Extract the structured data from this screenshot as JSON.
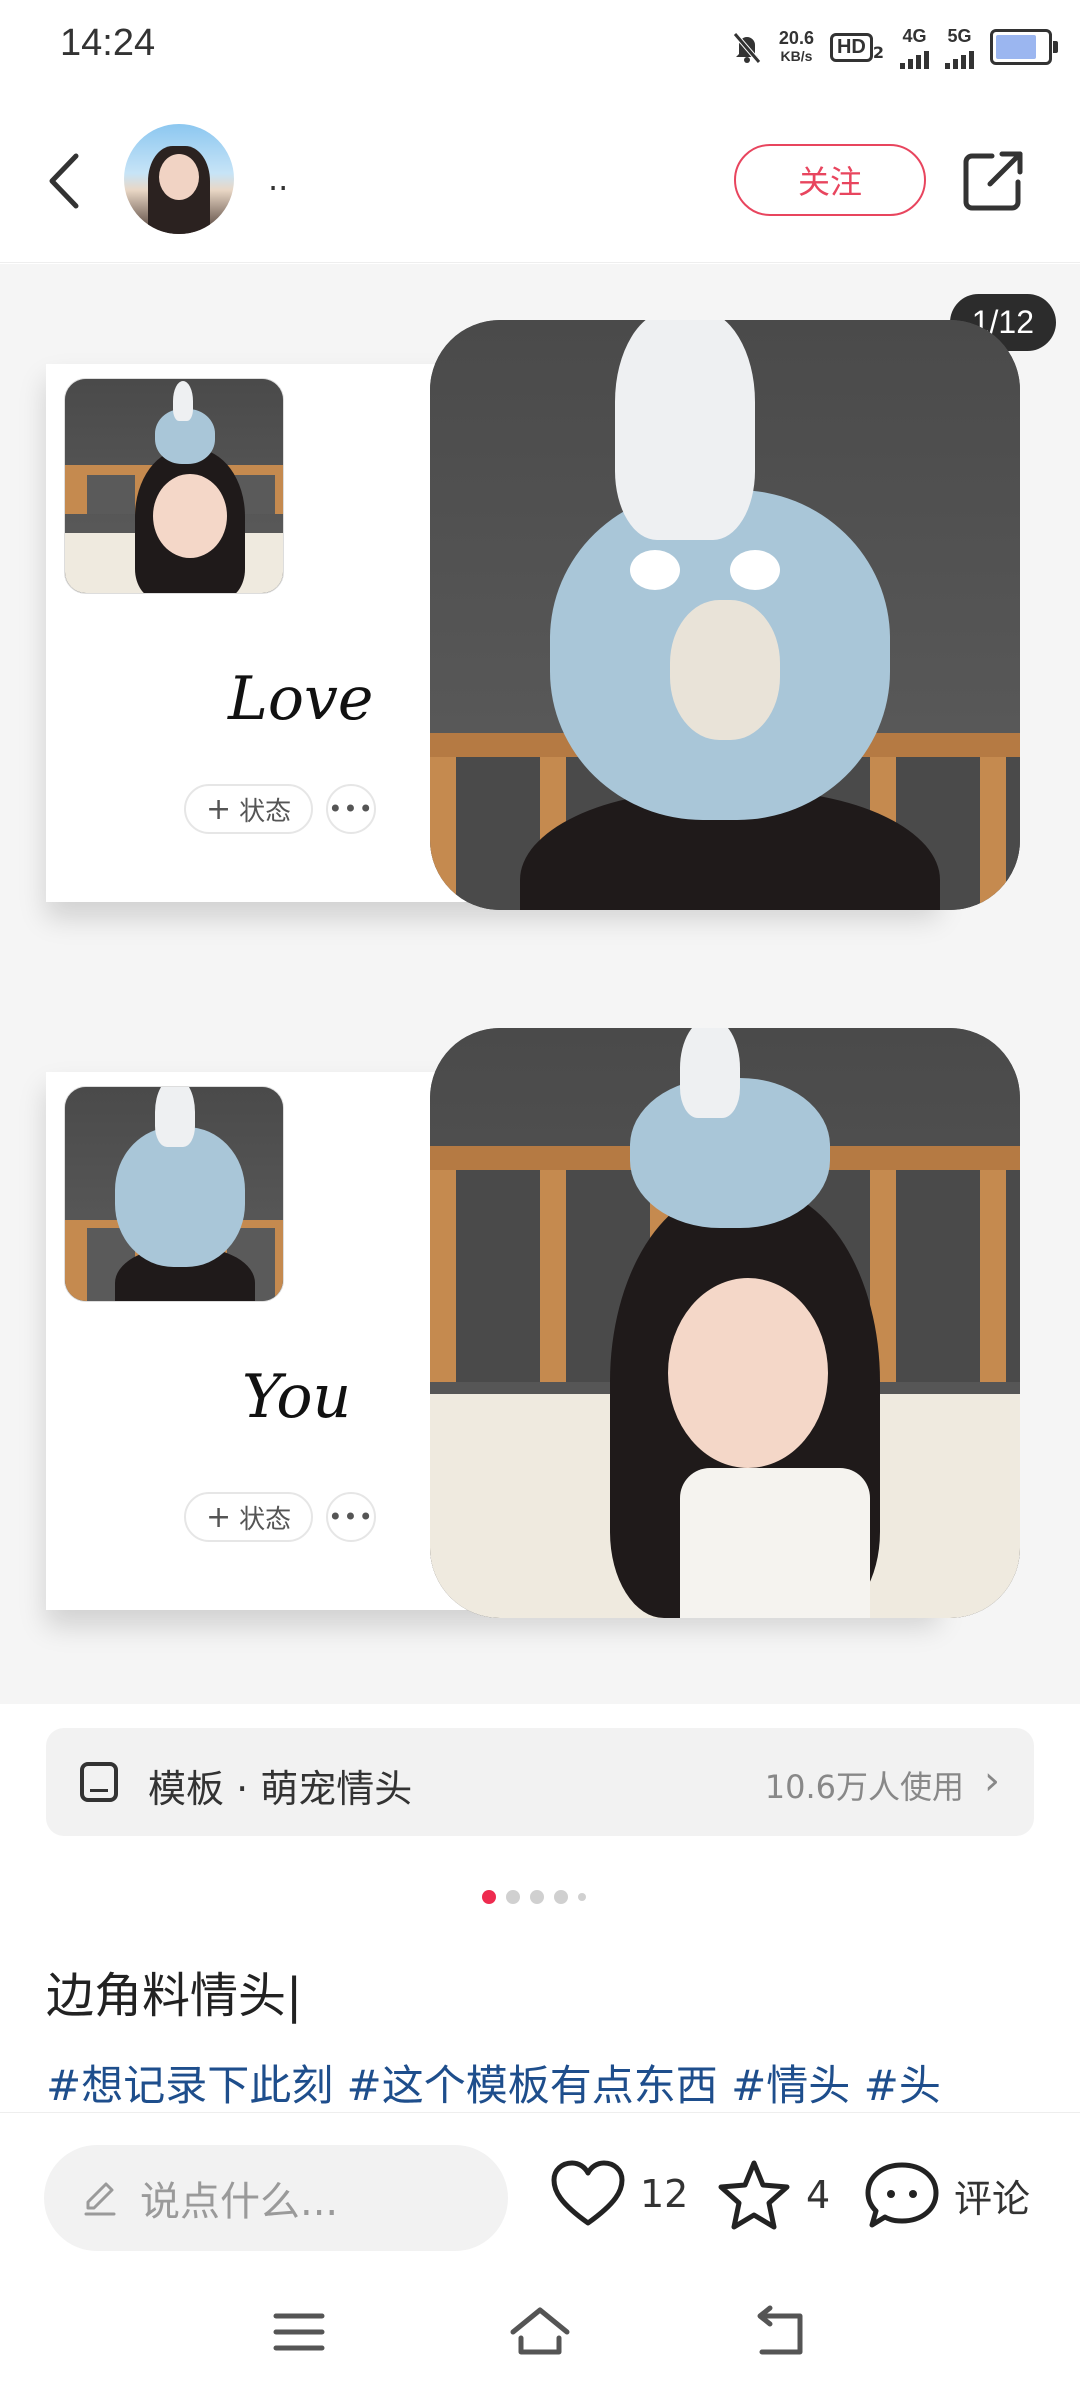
{
  "status_bar": {
    "time": "14:24",
    "net_speed_value": "20.6",
    "net_speed_unit": "KB/s",
    "hd_badge": "HD",
    "hd_sub": "2",
    "sig1_label": "4G",
    "sig2_label": "5G"
  },
  "header": {
    "username": "..",
    "follow_label": "关注"
  },
  "gallery": {
    "page_counter": "1/12",
    "card1_script": "Love",
    "card2_script": "You",
    "status_chip_label": "状态",
    "more_label": "•••"
  },
  "template": {
    "label": "模板 · 萌宠情头",
    "usage": "10.6万人使用"
  },
  "pager": {
    "count": 5,
    "active_index": 0
  },
  "post": {
    "title": "边角料情头|",
    "tags": "#想记录下此刻 #这个模板有点东西 #情头 #头"
  },
  "bottom_bar": {
    "comment_placeholder": "说点什么...",
    "like_count": "12",
    "fav_count": "4",
    "comment_label": "评论"
  },
  "colors": {
    "accent": "#e8455e",
    "tag_blue": "#1e4e8c"
  }
}
